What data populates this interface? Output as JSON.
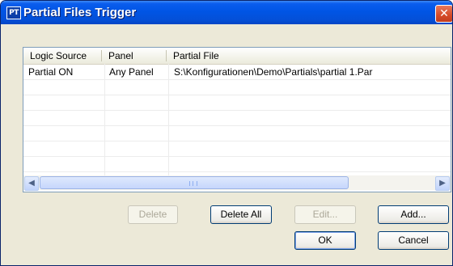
{
  "window": {
    "title": "Partial Files Trigger",
    "app_icon_text": "PT",
    "close_glyph": "✕"
  },
  "list": {
    "columns": [
      "Logic Source",
      "Panel",
      "Partial File"
    ],
    "rows": [
      [
        "Partial ON",
        "Any Panel",
        "S:\\Konfigurationen\\Demo\\Partials\\partial 1.Par"
      ]
    ]
  },
  "scrollbar": {
    "left_arrow": "◀",
    "right_arrow": "▶"
  },
  "buttons": {
    "delete": "Delete",
    "delete_all": "Delete All",
    "edit": "Edit...",
    "add": "Add...",
    "ok": "OK",
    "cancel": "Cancel"
  },
  "colors": {
    "titlebar": "#0055e5",
    "dialog_bg": "#ece9d8",
    "close_button": "#d54a28"
  }
}
